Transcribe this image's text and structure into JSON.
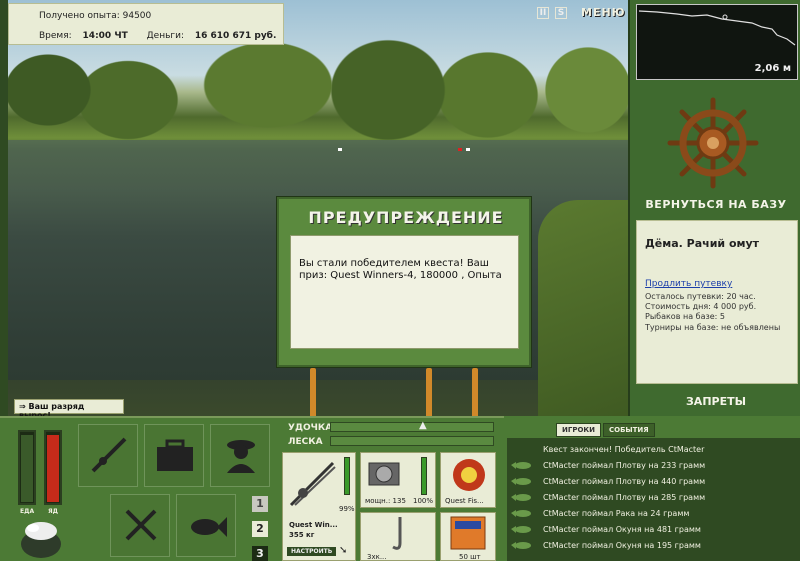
{
  "header": {
    "experience_label": "Получено опыта:",
    "experience_value": "94500",
    "time_label": "Время:",
    "time_value": "14:00 ЧТ",
    "money_label": "Деньги:",
    "money_value": "16 610 671 руб."
  },
  "top_icons": {
    "pause": "II",
    "sound": "S",
    "menu": "МЕНЮ"
  },
  "depth": {
    "value": "2,06 м"
  },
  "base": {
    "return_label": "ВЕРНУТЬСЯ НА БАЗУ",
    "name": "Дёма. Рачий омут",
    "extend_link": "Продлить путевку",
    "time_left": "Осталось путевки: 20 час.",
    "day_cost": "Стоимость дня: 4 000 руб.",
    "fishers": "Рыбаков на базе: 5",
    "tournaments": "Турниры на базе: не объявлены",
    "bans_label": "ЗАПРЕТЫ"
  },
  "dialog": {
    "title": "ПРЕДУПРЕЖДЕНИЕ",
    "message": "Вы стали победителем квеста! Ваш приз: Quest Winners-4, 180000 , Опыта"
  },
  "notice": {
    "rank": "Ваш разряд вырос!"
  },
  "meters": {
    "food_label": "ЕДА",
    "food_level": 0.95,
    "poison_label": "ЯД",
    "poison_level": 0.95
  },
  "slots": [
    "1",
    "2",
    "3"
  ],
  "tackle": {
    "rod_label": "УДОЧКА",
    "line_label": "ЛЕСКА",
    "rod_name": "Quest Win...",
    "rod_weight": "355 кг",
    "rod_percent": "99%",
    "reel_power": "мощн.: 135",
    "reel_percent": "100%",
    "line_name": "Quest Fis...",
    "adjust_label": "НАСТРОИТЬ",
    "hook_label": "3хк...",
    "bait_label": "50 шт"
  },
  "events": {
    "tabs": [
      "ИГРОКИ",
      "СОБЫТИЯ"
    ],
    "header": "Квест закончен! Победитель CtMacter",
    "items": [
      "CtMacter поймал Плотву на 233 грамм",
      "CtMacter поймал Плотву на 440 грамм",
      "CtMacter поймал Плотву на 285 грамм",
      "CtMacter поймал Рака на 24 грамм",
      "CtMacter поймал Окуня на 481 грамм",
      "CtMacter поймал Окуня на 195 грамм"
    ]
  },
  "colors": {
    "panel_green": "#4c7a35",
    "card_bg": "#e9ecd6",
    "meter_red": "#c62b1a"
  }
}
